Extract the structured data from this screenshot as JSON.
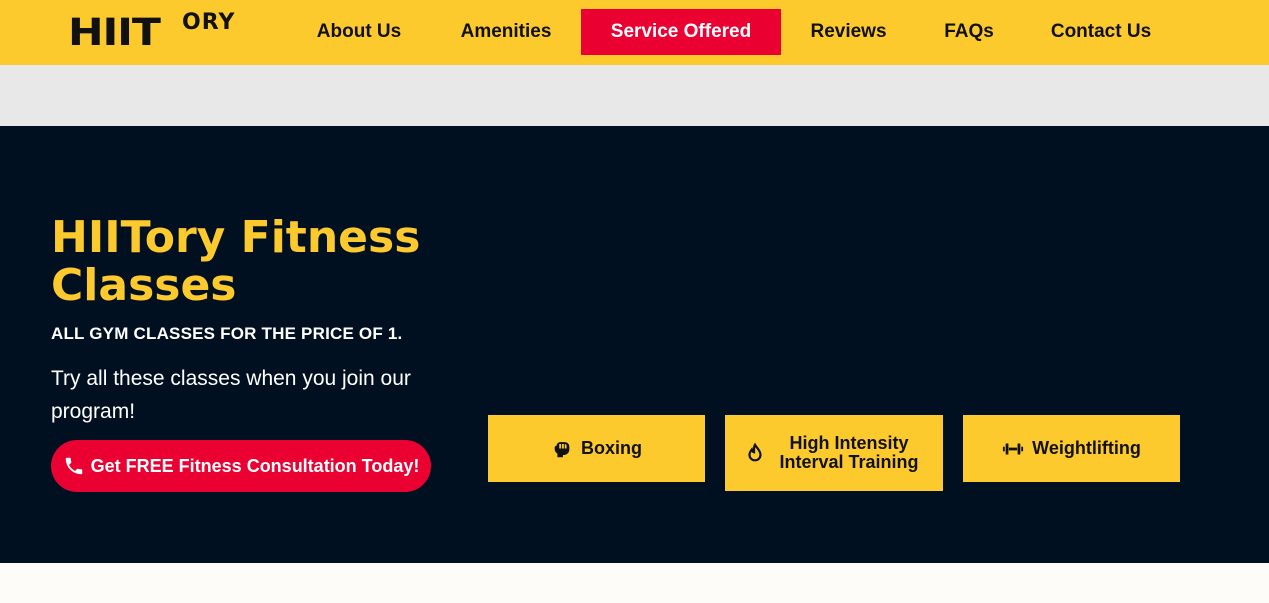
{
  "logo": {
    "big": "HIIT",
    "small": "ORY"
  },
  "nav": {
    "items": [
      {
        "label": "About Us"
      },
      {
        "label": "Amenities"
      },
      {
        "label": "Service Offered",
        "active": true
      },
      {
        "label": "Reviews"
      },
      {
        "label": "FAQs"
      },
      {
        "label": "Contact Us"
      }
    ]
  },
  "hero": {
    "title": "HIITory Fitness Classes",
    "subtitle": "ALL GYM CLASSES FOR THE PRICE OF 1.",
    "text": "Try all these classes when you join our program!",
    "cta_label": "Get FREE Fitness Consultation Today!",
    "cta_icon": "phone-icon"
  },
  "classes": [
    {
      "label": "Boxing",
      "icon": "boxing-glove-icon"
    },
    {
      "label": "High Intensity Interval Training",
      "icon": "flame-icon"
    },
    {
      "label": "Weightlifting",
      "icon": "dumbbell-icon"
    }
  ],
  "colors": {
    "brand_yellow": "#fdca2e",
    "accent_red": "#eb0032",
    "hero_navy": "#011021",
    "band_gray": "#e8e8e8"
  }
}
